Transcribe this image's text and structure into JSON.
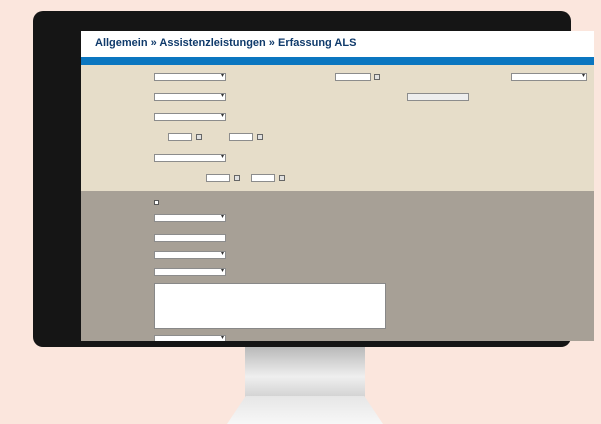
{
  "window": {
    "title": "Allgemein » Assistenzleistungen » Erfassung ALS"
  },
  "form_top": {
    "labels": [
      "",
      "",
      "",
      "",
      "",
      "",
      "",
      "",
      ""
    ],
    "fields": [
      "",
      "",
      "",
      "",
      "",
      "",
      "",
      "",
      "",
      "",
      "",
      "",
      "",
      ""
    ],
    "right_labels": [
      "",
      "",
      ""
    ]
  },
  "form_bottom": {
    "checkbox_label": "",
    "labels": [
      "",
      "",
      "",
      "",
      "",
      ""
    ],
    "fields": [
      "",
      "",
      "",
      "",
      ""
    ],
    "textarea_placeholder": ""
  },
  "colors": {
    "title": "#0f3a6b",
    "accent_bar": "#0a76c0",
    "top_panel": "#e6ddc9",
    "bottom_panel": "#a7a096",
    "background": "#fbe6dd"
  }
}
